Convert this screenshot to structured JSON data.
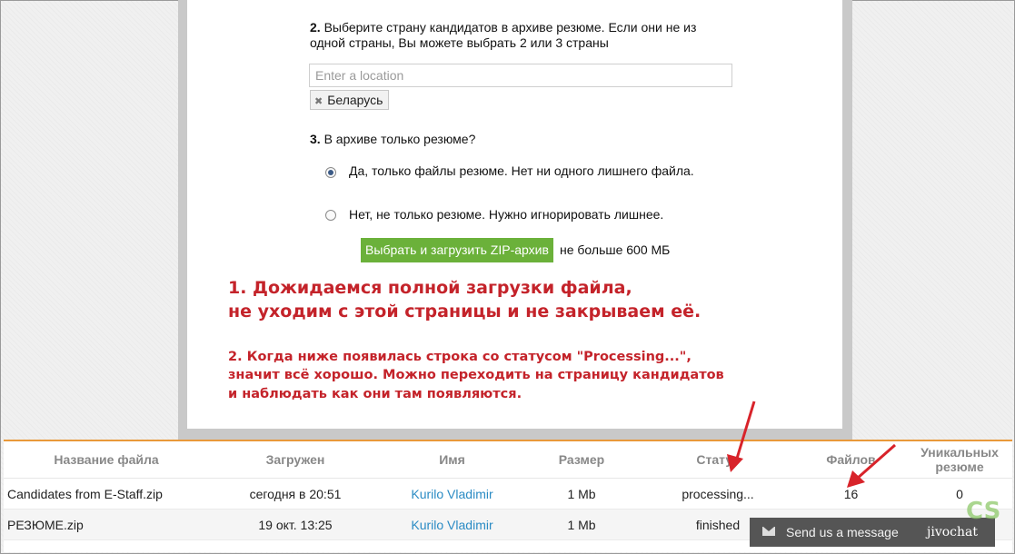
{
  "form": {
    "q2_num": "2.",
    "q2_text": "Выберите страну кандидатов в архиве резюме. Если они не из одной страны, Вы можете выбрать 2 или 3 страны",
    "location_placeholder": "Enter a location",
    "selected_country": "Беларусь",
    "q3_num": "3.",
    "q3_text": "В архиве только резюме?",
    "option_yes": "Да, только файлы резюме. Нет ни одного лишнего файла.",
    "option_no": "Нет, не только резюме. Нужно игнорировать лишнее.",
    "upload_button": "Выбрать и загрузить ZIP-архив",
    "upload_limit": "не больше 600 МБ"
  },
  "notes": {
    "note1_line1": "1. Дожидаемся полной загрузки файла,",
    "note1_line2": "не уходим с этой страницы и не закрываем её.",
    "note2_line1": "2. Когда ниже появилась строка со статусом \"Processing...\",",
    "note2_line2": "значит всё хорошо. Можно переходить на страницу кандидатов",
    "note2_line3": "и наблюдать как они там появляются."
  },
  "table": {
    "headers": {
      "filename": "Название файла",
      "uploaded": "Загружен",
      "name": "Имя",
      "size": "Размер",
      "status": "Статус",
      "files": "Файлов",
      "unique_line1": "Уникальных",
      "unique_line2": "резюме"
    },
    "rows": [
      {
        "filename": "Candidates from E-Staff.zip",
        "uploaded": "сегодня в 20:51",
        "name": "Kurilo Vladimir",
        "size": "1 Mb",
        "status": "processing...",
        "files": "16",
        "unique": "0"
      },
      {
        "filename": "РЕЗЮМЕ.zip",
        "uploaded": "19 окт. 13:25",
        "name": "Kurilo Vladimir",
        "size": "1 Mb",
        "status": "finished",
        "files": "",
        "unique": ""
      }
    ]
  },
  "chat": {
    "label": "Send us a message",
    "brand": "jivochat"
  },
  "watermark": "CS",
  "colors": {
    "accent_orange": "#e9993a",
    "button_green": "#6bb13a",
    "annotation_red": "#c4232a",
    "link_blue": "#2a8bc4"
  }
}
